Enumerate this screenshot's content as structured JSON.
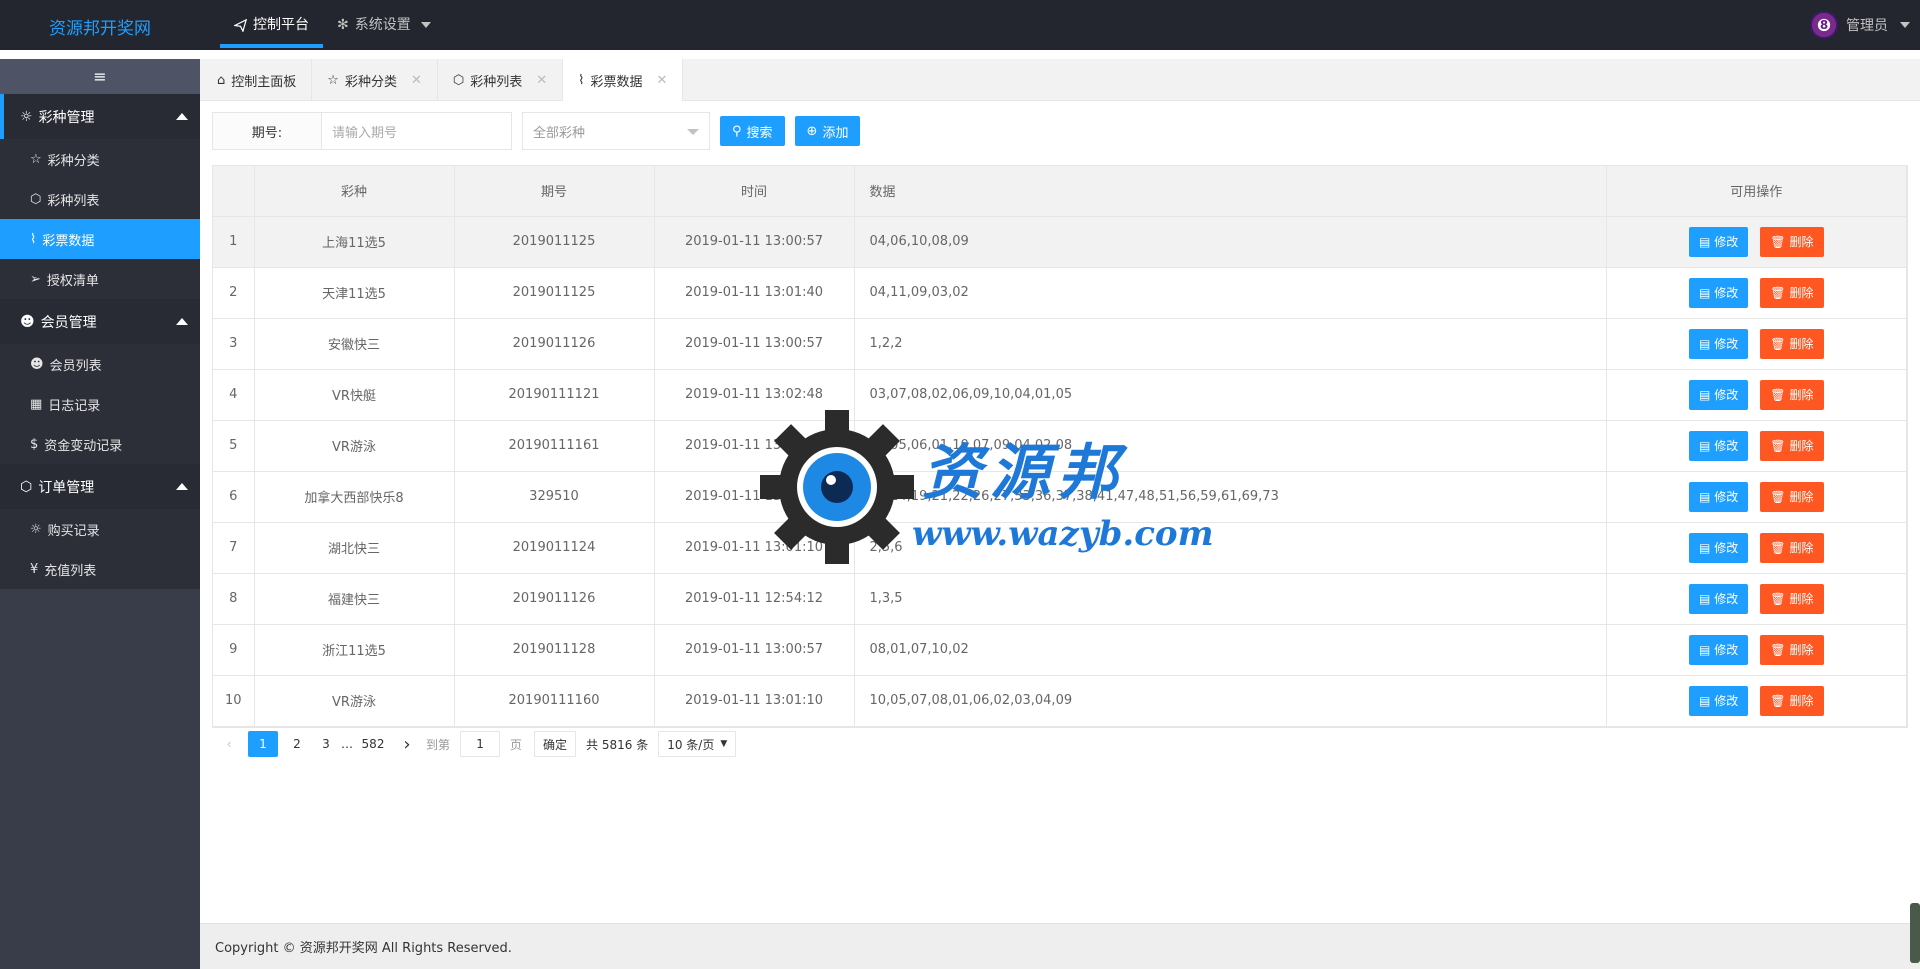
{
  "app": {
    "logo": "资源邦开奖网"
  },
  "topnav": {
    "items": [
      {
        "label": "控制平台",
        "icon": "send-icon",
        "active": true
      },
      {
        "label": "系统设置",
        "icon": "gear-icon",
        "active": false
      }
    ],
    "user": {
      "label": "管理员",
      "avatar_text": "8"
    }
  },
  "sidebar": {
    "toggle": "≡",
    "groups": [
      {
        "label": "彩种管理",
        "icon": "fire-icon",
        "items": [
          {
            "label": "彩种分类",
            "icon": "star-icon"
          },
          {
            "label": "彩种列表",
            "icon": "cube-icon"
          },
          {
            "label": "彩票数据",
            "icon": "chart-icon",
            "active": true
          },
          {
            "label": "授权清单",
            "icon": "send-icon"
          }
        ]
      },
      {
        "label": "会员管理",
        "icon": "users-icon",
        "items": [
          {
            "label": "会员列表",
            "icon": "users-icon"
          },
          {
            "label": "日志记录",
            "icon": "calendar-icon"
          },
          {
            "label": "资金变动记录",
            "icon": "dollar-icon"
          }
        ]
      },
      {
        "label": "订单管理",
        "icon": "cube-icon",
        "items": [
          {
            "label": "购买记录",
            "icon": "fire-icon"
          },
          {
            "label": "充值列表",
            "icon": "yen-icon"
          }
        ]
      }
    ]
  },
  "tabs": [
    {
      "label": "控制主面板",
      "icon": "home-icon",
      "closable": false
    },
    {
      "label": "彩种分类",
      "icon": "star-icon",
      "closable": true
    },
    {
      "label": "彩种列表",
      "icon": "cube-icon",
      "closable": true
    },
    {
      "label": "彩票数据",
      "icon": "chart-icon",
      "closable": true,
      "active": true
    }
  ],
  "filter": {
    "period_label": "期号:",
    "period_placeholder": "请输入期号",
    "lottery_select": "全部彩种",
    "search_label": "搜索",
    "add_label": "添加"
  },
  "table": {
    "columns": [
      "",
      "彩种",
      "期号",
      "时间",
      "数据",
      "可用操作"
    ],
    "edit_label": "修改",
    "delete_label": "删除",
    "rows": [
      {
        "no": "1",
        "lottery": "上海11选5",
        "period": "2019011125",
        "time": "2019-01-11 13:00:57",
        "data": "04,06,10,08,09"
      },
      {
        "no": "2",
        "lottery": "天津11选5",
        "period": "2019011125",
        "time": "2019-01-11 13:01:40",
        "data": "04,11,09,03,02"
      },
      {
        "no": "3",
        "lottery": "安徽快三",
        "period": "2019011126",
        "time": "2019-01-11 13:00:57",
        "data": "1,2,2"
      },
      {
        "no": "4",
        "lottery": "VR快艇",
        "period": "20190111121",
        "time": "2019-01-11 13:02:48",
        "data": "03,07,08,02,06,09,10,04,01,05"
      },
      {
        "no": "5",
        "lottery": "VR游泳",
        "period": "20190111161",
        "time": "2019-01-11 13:02:38",
        "data": "03,05,06,01,10,07,09,04,02,08"
      },
      {
        "no": "6",
        "lottery": "加拿大西部快乐8",
        "period": "329510",
        "time": "2019-01-11 13:00:00",
        "data": "04,14,19,21,22,26,27,33,36,37,38,41,47,48,51,56,59,61,69,73"
      },
      {
        "no": "7",
        "lottery": "湖北快三",
        "period": "2019011124",
        "time": "2019-01-11 13:01:10",
        "data": "2,5,6"
      },
      {
        "no": "8",
        "lottery": "福建快三",
        "period": "2019011126",
        "time": "2019-01-11 12:54:12",
        "data": "1,3,5"
      },
      {
        "no": "9",
        "lottery": "浙江11选5",
        "period": "2019011128",
        "time": "2019-01-11 13:00:57",
        "data": "08,01,07,10,02"
      },
      {
        "no": "10",
        "lottery": "VR游泳",
        "period": "20190111160",
        "time": "2019-01-11 13:01:10",
        "data": "10,05,07,08,01,06,02,03,04,09"
      }
    ]
  },
  "pager": {
    "prev": "‹",
    "pages": [
      "1",
      "2",
      "3"
    ],
    "ellipsis": "…",
    "last": "582",
    "next": "›",
    "goto_label": "到第",
    "goto_value": "1",
    "page_unit": "页",
    "confirm": "确定",
    "total": "共 5816 条",
    "page_size": "10 条/页"
  },
  "footer": {
    "text": "Copyright © 资源邦开奖网 All Rights Reserved."
  },
  "watermark": {
    "title": "资源邦",
    "url": "www.wazyb.com"
  },
  "colors": {
    "accent": "#1e9fff",
    "danger": "#ff5722",
    "topbar": "#23262e",
    "sidebar": "#393d49"
  }
}
